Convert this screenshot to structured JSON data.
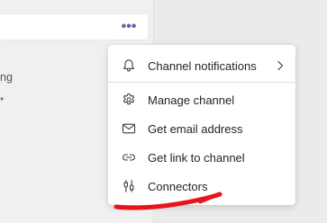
{
  "left_panel": {
    "more_options_glyph": "•••",
    "partial_text": "ng",
    "partial_dot": "•"
  },
  "menu": {
    "items": [
      {
        "label": "Channel notifications",
        "icon": "bell-icon",
        "has_submenu": true
      },
      {
        "label": "Manage channel",
        "icon": "gear-icon",
        "has_submenu": false
      },
      {
        "label": "Get email address",
        "icon": "mail-icon",
        "has_submenu": false
      },
      {
        "label": "Get link to channel",
        "icon": "link-icon",
        "has_submenu": false
      },
      {
        "label": "Connectors",
        "icon": "connectors-icon",
        "has_submenu": false
      }
    ]
  },
  "colors": {
    "accent": "#6264a7",
    "annotation": "#e8141b",
    "menu_text": "#252423"
  }
}
